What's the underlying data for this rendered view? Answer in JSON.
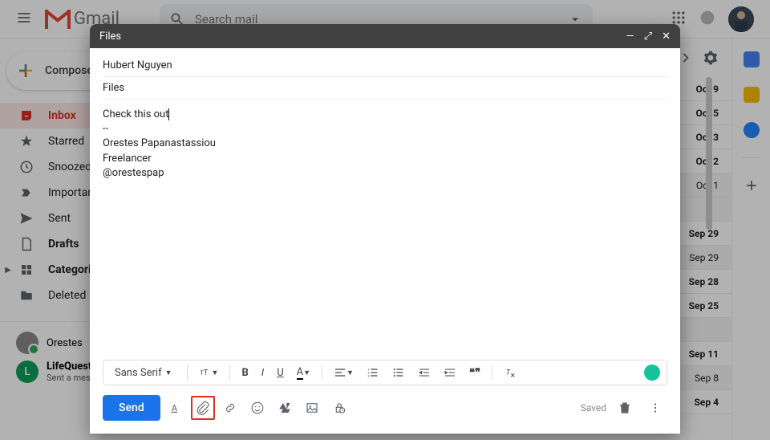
{
  "header": {
    "logo_text": "Gmail",
    "search_placeholder": "Search mail"
  },
  "sidebar": {
    "compose": "Compose",
    "items": [
      {
        "label": "Inbox",
        "icon": "inbox",
        "active": true,
        "bold": true
      },
      {
        "label": "Starred",
        "icon": "star",
        "active": false,
        "bold": false
      },
      {
        "label": "Snoozed",
        "icon": "clock",
        "active": false,
        "bold": false
      },
      {
        "label": "Important",
        "icon": "important",
        "active": false,
        "bold": false
      },
      {
        "label": "Sent",
        "icon": "send",
        "active": false,
        "bold": false
      },
      {
        "label": "Drafts",
        "icon": "draft",
        "active": false,
        "bold": true
      },
      {
        "label": "Categories",
        "icon": "categories",
        "active": false,
        "bold": true
      },
      {
        "label": "Deleted Items",
        "icon": "folder",
        "active": false,
        "bold": false
      }
    ],
    "chat_user": {
      "name": "Orestes"
    },
    "chat_contact": {
      "name": "LifeQuest",
      "status": "Sent a message"
    }
  },
  "email_dates": [
    {
      "date": "Oct 9",
      "unread": true
    },
    {
      "date": "Oct 5",
      "unread": true
    },
    {
      "date": "Oct 3",
      "unread": true
    },
    {
      "date": "Oct 2",
      "unread": true
    },
    {
      "date": "Oct 1",
      "unread": false
    },
    {
      "date": "",
      "unread": false
    },
    {
      "date": "Sep 29",
      "unread": true
    },
    {
      "date": "Sep 29",
      "unread": false
    },
    {
      "date": "Sep 28",
      "unread": true
    },
    {
      "date": "Sep 25",
      "unread": true
    },
    {
      "date": "",
      "unread": false
    },
    {
      "date": "Sep 11",
      "unread": true
    },
    {
      "date": "Sep 8",
      "unread": false
    },
    {
      "date": "Sep 4",
      "unread": true
    }
  ],
  "compose_dialog": {
    "title": "Files",
    "to": "Hubert Nguyen",
    "subject": "Files",
    "body_line1": "Check this out",
    "body_sep": "--",
    "sig_name": "Orestes Papanastassiou",
    "sig_title": "Freelancer",
    "sig_handle": "@orestespap",
    "font": "Sans Serif",
    "send": "Send",
    "saved": "Saved"
  }
}
